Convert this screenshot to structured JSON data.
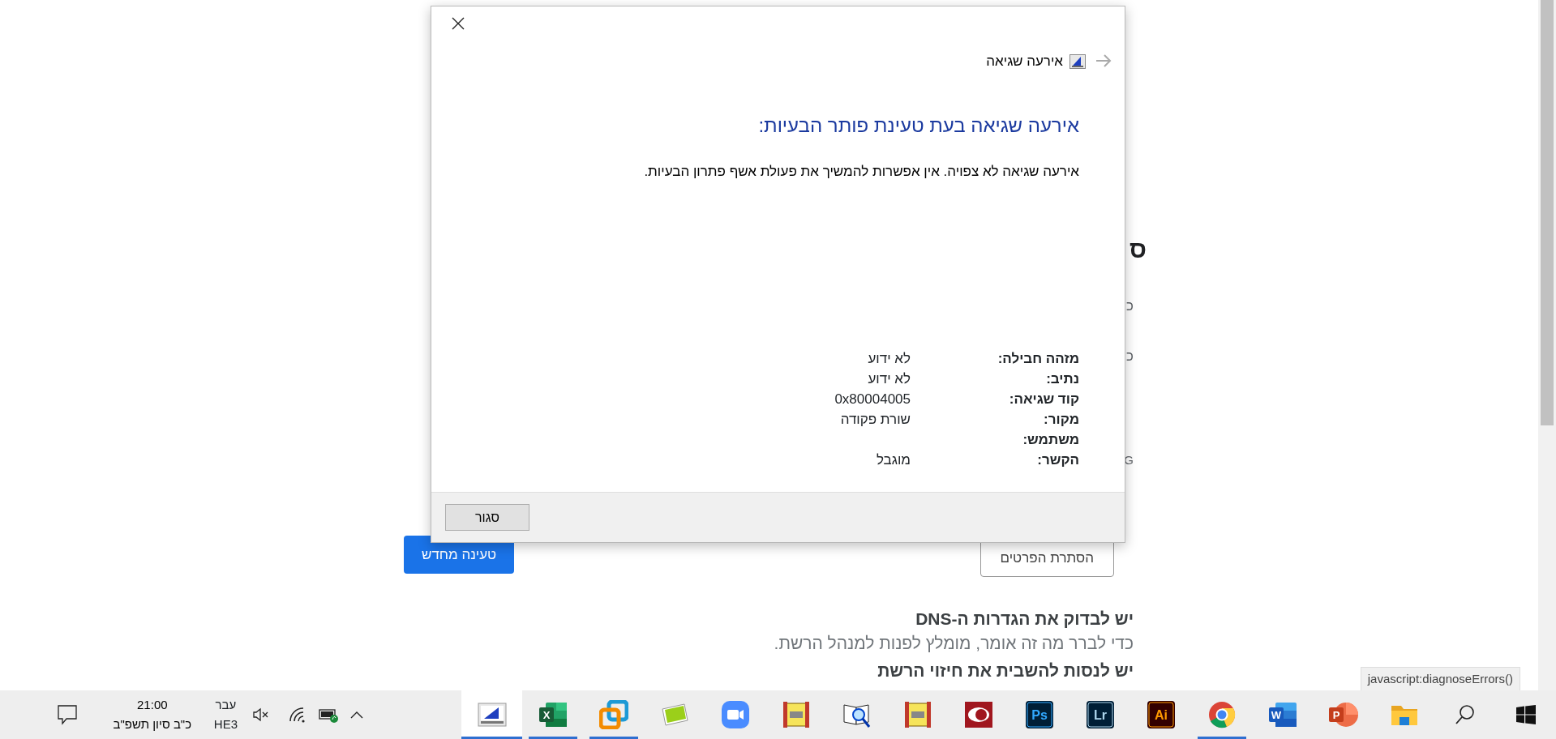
{
  "background_page": {
    "cut_texts": [
      {
        "kind": "heading",
        "text": "ס"
      },
      {
        "kind": "line",
        "text": "כ"
      },
      {
        "kind": "line",
        "text": "כ"
      },
      {
        "kind": "small",
        "text": "G"
      }
    ],
    "buttons": [
      {
        "kind": "primary",
        "label": "טעינה מחדש"
      },
      {
        "kind": "outline",
        "label": "הסתרת הפרטים"
      }
    ],
    "sections": [
      {
        "heading": "יש לבדוק את הגדרות ה-DNS",
        "text": "כדי לברר מה זה אומר, מומלץ לפנות למנהל הרשת."
      },
      {
        "heading": "יש לנסות להשבית את חיזוי הרשת"
      }
    ]
  },
  "status_link": "javascript:diagnoseErrors()",
  "dialog": {
    "title": "אירעה שגיאה",
    "heading": "אירעה שגיאה בעת טעינת פותר הבעיות:",
    "message": "אירעה שגיאה לא צפויה. אין אפשרות להמשיך את פעולת אשף פתרון הבעיות.",
    "details": [
      {
        "label": "מזהה חבילה:",
        "value": "לא ידוע"
      },
      {
        "label": "נתיב:",
        "value": "לא ידוע"
      },
      {
        "label": "קוד שגיאה:",
        "value": "0x80004005"
      },
      {
        "label": "מקור:",
        "value": "שורת פקודה"
      },
      {
        "label": "משתמש:"
      },
      {
        "label": "הקשר:",
        "value": "מוגבל"
      }
    ],
    "close_button": "סגור"
  },
  "taskbar": {
    "clock": {
      "time": "21:00",
      "date": "כ\"ב סיון תשפ\"ב"
    },
    "language": {
      "name": "עבר",
      "layout": "HE3"
    },
    "apps": [
      {
        "kind": "folder",
        "running": false,
        "selected": false
      },
      {
        "kind": "powerpoint",
        "label": "P",
        "running": false,
        "selected": false
      },
      {
        "kind": "word",
        "label": "W",
        "running": false,
        "selected": false
      },
      {
        "kind": "chrome",
        "running": true,
        "selected": false
      },
      {
        "kind": "illustrator",
        "label": "Ai",
        "running": false,
        "selected": false
      },
      {
        "kind": "lightroom",
        "label": "Lr",
        "running": false,
        "selected": false
      },
      {
        "kind": "photoshop",
        "label": "Ps",
        "running": false,
        "selected": false
      },
      {
        "kind": "eye",
        "running": false,
        "selected": false
      },
      {
        "kind": "scroll",
        "running": false,
        "selected": false
      },
      {
        "kind": "book",
        "running": false,
        "selected": false
      },
      {
        "kind": "scroll",
        "running": false,
        "selected": false
      },
      {
        "kind": "zoom",
        "running": false,
        "selected": false
      },
      {
        "kind": "green-card",
        "running": false,
        "selected": false
      },
      {
        "kind": "vmware",
        "running": true,
        "selected": false
      },
      {
        "kind": "excel",
        "label": "X",
        "running": true,
        "selected": false
      },
      {
        "kind": "troubleshooter",
        "running": true,
        "selected": true
      }
    ]
  }
}
